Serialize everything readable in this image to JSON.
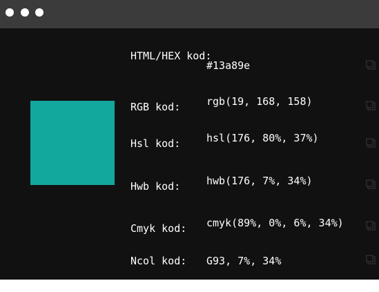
{
  "window": {
    "controls": [
      "close",
      "minimize",
      "maximize"
    ]
  },
  "swatch": {
    "color": "#13a89e"
  },
  "colors": {
    "accent": "#13a89e",
    "background": "#111111",
    "titlebar": "#3b3b3b",
    "text": "#ffffff"
  },
  "codes": [
    {
      "label": "HTML/HEX kod:",
      "value": "#13a89e",
      "icon": "copy-icon"
    },
    {
      "label": "RGB kod:",
      "value": "rgb(19, 168, 158)",
      "icon": "copy-icon"
    },
    {
      "label": "Hsl kod:",
      "value": "hsl(176, 80%, 37%)",
      "icon": "copy-icon"
    },
    {
      "label": "Hwb kod:",
      "value": "hwb(176, 7%, 34%)",
      "icon": "copy-icon"
    },
    {
      "label": "Cmyk kod:",
      "value": "cmyk(89%, 0%, 6%, 34%)",
      "icon": "copy-icon"
    },
    {
      "label": "Ncol kod:",
      "value": "G93, 7%, 34%",
      "icon": "copy-icon"
    }
  ]
}
